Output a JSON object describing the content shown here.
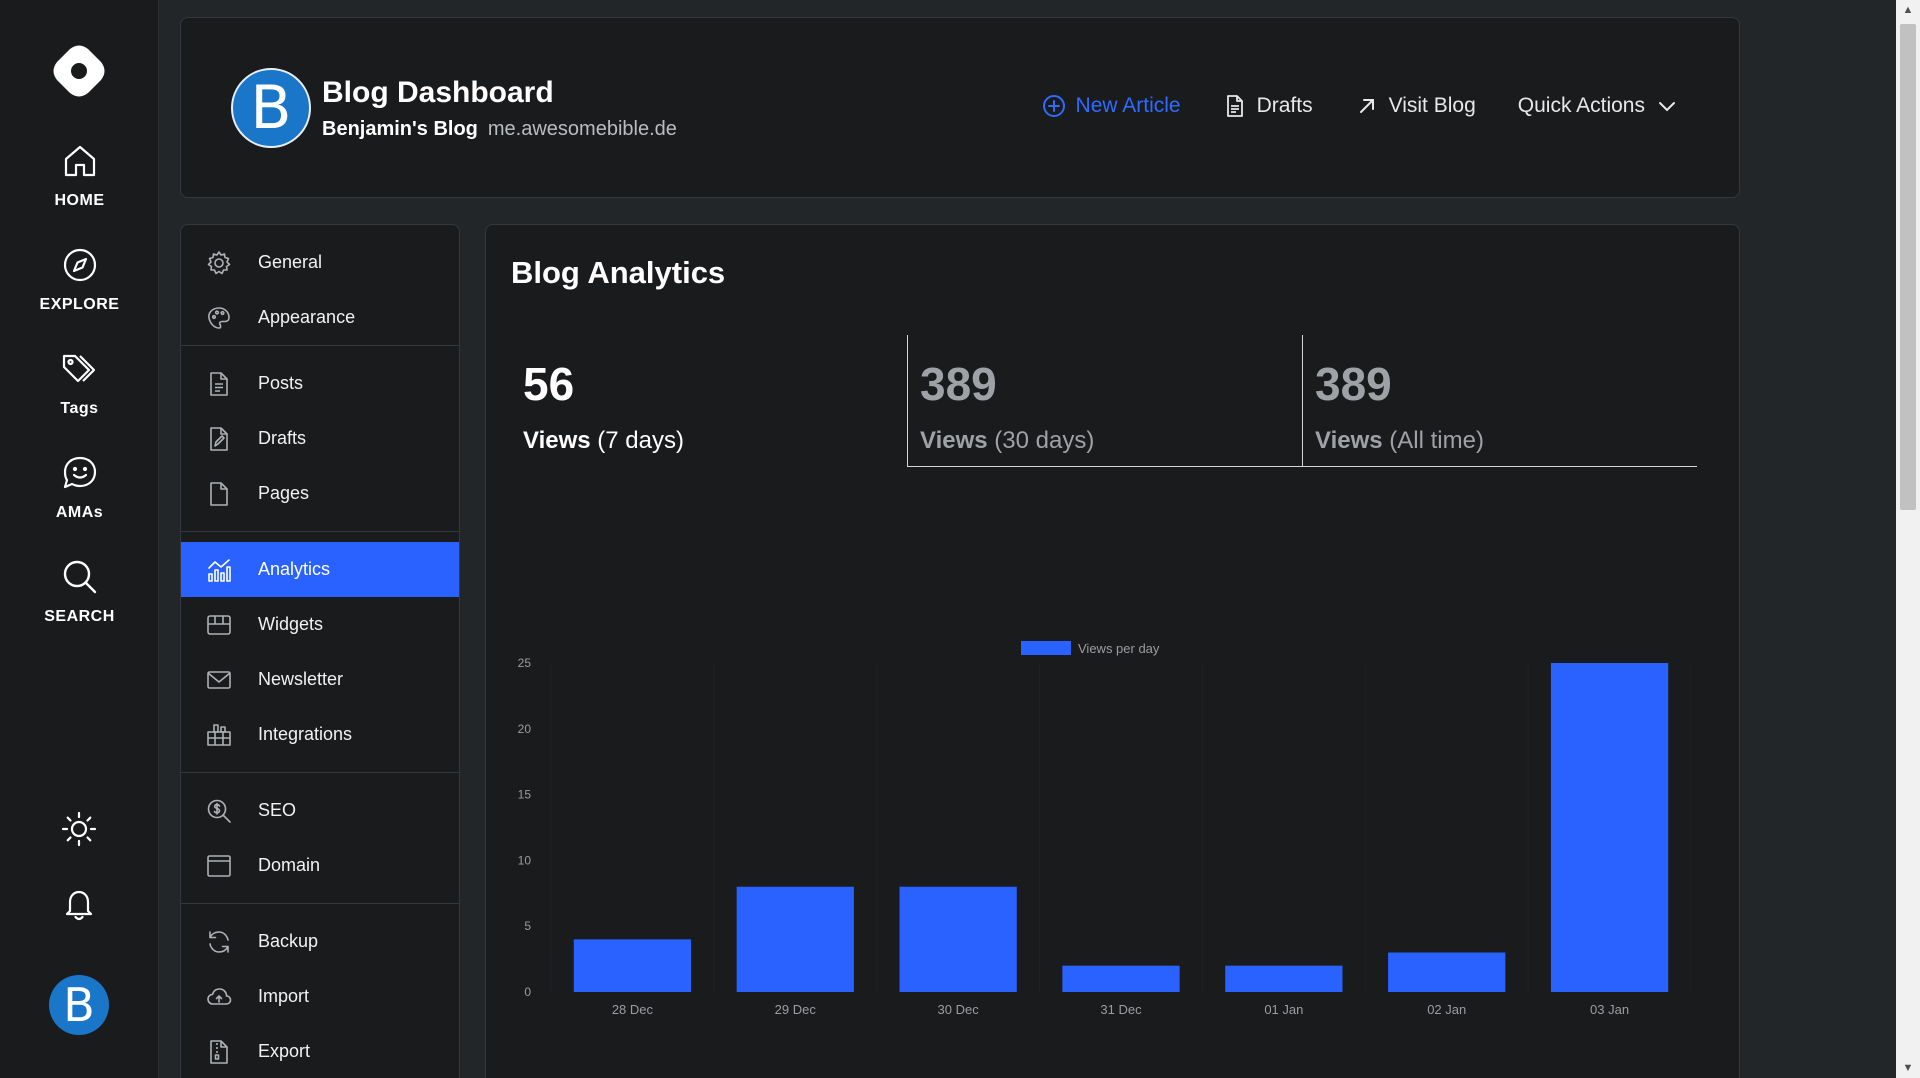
{
  "rail": {
    "items": [
      {
        "label": "HOME"
      },
      {
        "label": "EXPLORE"
      },
      {
        "label": "Tags"
      },
      {
        "label": "AMAs"
      },
      {
        "label": "SEARCH"
      }
    ],
    "avatar_letter": "B"
  },
  "header": {
    "avatar_letter": "B",
    "title": "Blog Dashboard",
    "blog_name": "Benjamin's Blog",
    "domain": "me.awesomebible.de",
    "actions": {
      "new_article": "New Article",
      "drafts": "Drafts",
      "visit_blog": "Visit Blog",
      "quick_actions": "Quick Actions"
    },
    "accent": "#2f6bff"
  },
  "menu": {
    "groups": [
      [
        {
          "label": "General"
        },
        {
          "label": "Appearance"
        }
      ],
      [
        {
          "label": "Posts"
        },
        {
          "label": "Drafts"
        },
        {
          "label": "Pages"
        }
      ],
      [
        {
          "label": "Analytics"
        },
        {
          "label": "Widgets"
        },
        {
          "label": "Newsletter"
        },
        {
          "label": "Integrations"
        }
      ],
      [
        {
          "label": "SEO"
        },
        {
          "label": "Domain"
        }
      ],
      [
        {
          "label": "Backup"
        },
        {
          "label": "Import"
        },
        {
          "label": "Export"
        }
      ]
    ],
    "active": "Analytics",
    "active_color": "#2962ff"
  },
  "main": {
    "title": "Blog Analytics",
    "stats": [
      {
        "value": "56",
        "label_bold": "Views",
        "label_rest": " (7 days)"
      },
      {
        "value": "389",
        "label_bold": "Views",
        "label_rest": " (30 days)"
      },
      {
        "value": "389",
        "label_bold": "Views",
        "label_rest": " (All time)"
      }
    ]
  },
  "chart_data": {
    "type": "bar",
    "categories": [
      "28 Dec",
      "29 Dec",
      "30 Dec",
      "31 Dec",
      "01 Jan",
      "02 Jan",
      "03 Jan"
    ],
    "series": [
      {
        "name": "Views per day",
        "values": [
          4,
          8,
          8,
          2,
          2,
          3,
          25
        ],
        "color": "#2962ff"
      }
    ],
    "ylim": [
      0,
      25
    ],
    "yticks": [
      0,
      5,
      10,
      15,
      20,
      25
    ],
    "legend_position": "top-center",
    "grid": true
  }
}
